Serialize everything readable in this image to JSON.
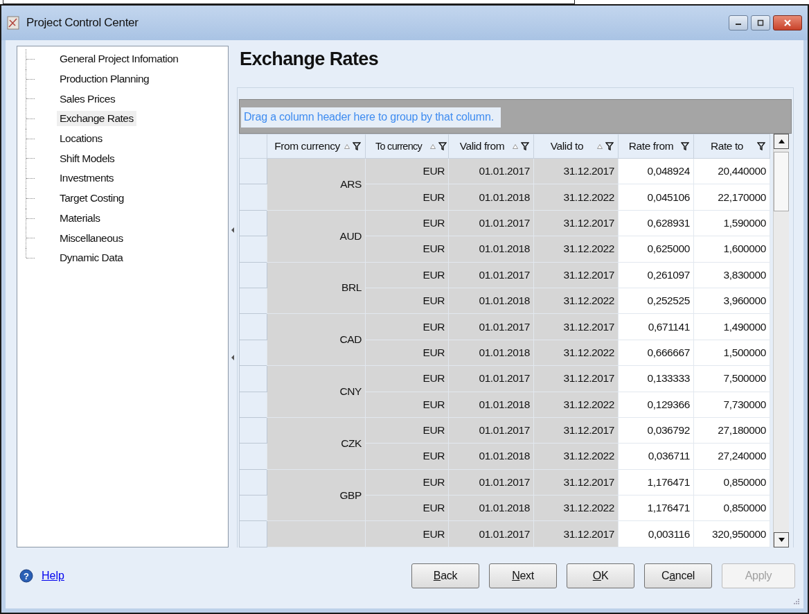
{
  "window": {
    "title": "Project Control Center"
  },
  "tree": {
    "items": [
      {
        "label": "General Project Infomation",
        "selected": false
      },
      {
        "label": "Production Planning",
        "selected": false
      },
      {
        "label": "Sales Prices",
        "selected": false
      },
      {
        "label": "Exchange Rates",
        "selected": true
      },
      {
        "label": "Locations",
        "selected": false
      },
      {
        "label": "Shift Models",
        "selected": false
      },
      {
        "label": "Investments",
        "selected": false
      },
      {
        "label": "Target Costing",
        "selected": false
      },
      {
        "label": "Materials",
        "selected": false
      },
      {
        "label": "Miscellaneous",
        "selected": false
      },
      {
        "label": "Dynamic Data",
        "selected": false
      }
    ]
  },
  "page_title": "Exchange Rates",
  "grid": {
    "group_hint": "Drag a column header here to group by that column.",
    "columns": [
      {
        "label": "From currency",
        "sortable": true
      },
      {
        "label": "To currency",
        "sortable": true
      },
      {
        "label": "Valid from",
        "sortable": true
      },
      {
        "label": "Valid to",
        "sortable": true
      },
      {
        "label": "Rate from",
        "sortable": false
      },
      {
        "label": "Rate to",
        "sortable": false
      }
    ],
    "groups": [
      {
        "from": "ARS",
        "rows": [
          [
            "EUR",
            "01.01.2017",
            "31.12.2017",
            "0,048924",
            "20,440000"
          ],
          [
            "EUR",
            "01.01.2018",
            "31.12.2022",
            "0,045106",
            "22,170000"
          ]
        ]
      },
      {
        "from": "AUD",
        "rows": [
          [
            "EUR",
            "01.01.2017",
            "31.12.2017",
            "0,628931",
            "1,590000"
          ],
          [
            "EUR",
            "01.01.2018",
            "31.12.2022",
            "0,625000",
            "1,600000"
          ]
        ]
      },
      {
        "from": "BRL",
        "rows": [
          [
            "EUR",
            "01.01.2017",
            "31.12.2017",
            "0,261097",
            "3,830000"
          ],
          [
            "EUR",
            "01.01.2018",
            "31.12.2022",
            "0,252525",
            "3,960000"
          ]
        ]
      },
      {
        "from": "CAD",
        "rows": [
          [
            "EUR",
            "01.01.2017",
            "31.12.2017",
            "0,671141",
            "1,490000"
          ],
          [
            "EUR",
            "01.01.2018",
            "31.12.2022",
            "0,666667",
            "1,500000"
          ]
        ]
      },
      {
        "from": "CNY",
        "rows": [
          [
            "EUR",
            "01.01.2017",
            "31.12.2017",
            "0,133333",
            "7,500000"
          ],
          [
            "EUR",
            "01.01.2018",
            "31.12.2022",
            "0,129366",
            "7,730000"
          ]
        ]
      },
      {
        "from": "CZK",
        "rows": [
          [
            "EUR",
            "01.01.2017",
            "31.12.2017",
            "0,036792",
            "27,180000"
          ],
          [
            "EUR",
            "01.01.2018",
            "31.12.2022",
            "0,036711",
            "27,240000"
          ]
        ]
      },
      {
        "from": "GBP",
        "rows": [
          [
            "EUR",
            "01.01.2017",
            "31.12.2017",
            "1,176471",
            "0,850000"
          ],
          [
            "EUR",
            "01.01.2018",
            "31.12.2022",
            "1,176471",
            "0,850000"
          ]
        ]
      },
      {
        "rows": [
          [
            "EUR",
            "01.01.2017",
            "31.12.2017",
            "0,003116",
            "320,950000"
          ]
        ]
      }
    ]
  },
  "help_icon": "?",
  "help_link": "Help",
  "buttons": [
    {
      "access_key": "B",
      "after": "ack",
      "disabled": false
    },
    {
      "access_key": "N",
      "after": "ext",
      "disabled": false
    },
    {
      "access_key": "O",
      "after": "K",
      "disabled": false
    },
    {
      "before": "C",
      "access_key": "a",
      "after": "ncel",
      "disabled": false
    },
    {
      "before": "Apply",
      "disabled": true
    }
  ]
}
